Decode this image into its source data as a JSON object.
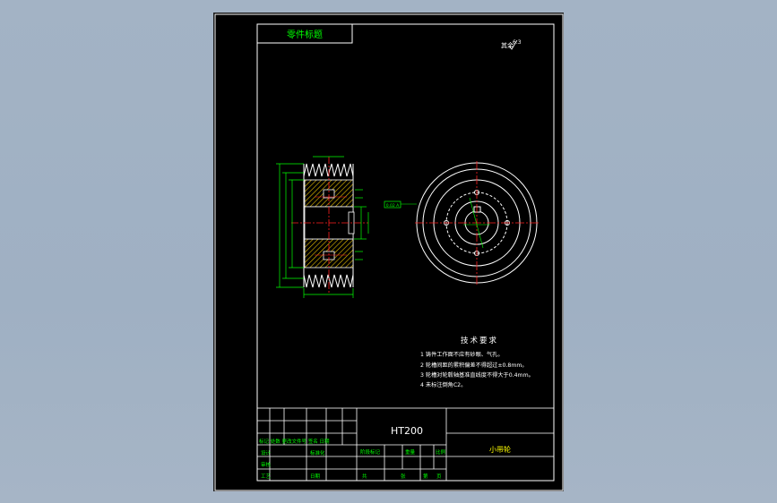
{
  "drawing": {
    "title_block_top_left": "零件标题",
    "surface_roughness_note": "其余",
    "surface_roughness_value": "6.3",
    "datum_callout": "0.02 A"
  },
  "technical_requirements": {
    "heading": "技术要求",
    "items": [
      "1  铸件工作面不应有砂眼、气孔。",
      "2  轮槽间距的累积偏差不得超过±0.8mm。",
      "3  轮槽对轮毂轴基准直线度不得大于0.4mm。",
      "4  未标注倒角C2。"
    ]
  },
  "title_block": {
    "material": "HT200",
    "part_name": "小带轮",
    "row_marks": "标记 处数  更改文件号  签名  日期",
    "designer": "设计",
    "standardization": "标准化",
    "review": "审核",
    "process": "工艺",
    "approve": "日期",
    "stage_mark": "阶段标记",
    "weight": "重量",
    "scale": "比例",
    "sheet_total": "共",
    "sheet_no": "张",
    "sheet_of": "第",
    "page": "页"
  }
}
